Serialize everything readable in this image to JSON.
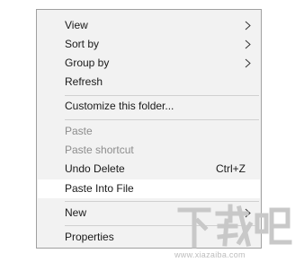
{
  "context_menu": {
    "items": [
      {
        "label": "View",
        "submenu": true,
        "disabled": false
      },
      {
        "label": "Sort by",
        "submenu": true,
        "disabled": false
      },
      {
        "label": "Group by",
        "submenu": true,
        "disabled": false
      },
      {
        "label": "Refresh",
        "disabled": false
      },
      {
        "label": "Customize this folder...",
        "disabled": false
      },
      {
        "label": "Paste",
        "disabled": true
      },
      {
        "label": "Paste shortcut",
        "disabled": true
      },
      {
        "label": "Undo Delete",
        "shortcut": "Ctrl+Z",
        "disabled": false
      },
      {
        "label": "Paste Into File",
        "disabled": false,
        "highlighted": true
      },
      {
        "label": "New",
        "submenu": true,
        "disabled": false
      },
      {
        "label": "Properties",
        "disabled": false
      }
    ]
  },
  "watermark": {
    "brand": "下载吧",
    "url": "www.xiazaiba.com"
  },
  "colors": {
    "menu_background": "#f2f2f2",
    "menu_border": "#a0a0a0",
    "disabled_text": "#8d8d8d",
    "highlight_background": "#ffffff"
  }
}
